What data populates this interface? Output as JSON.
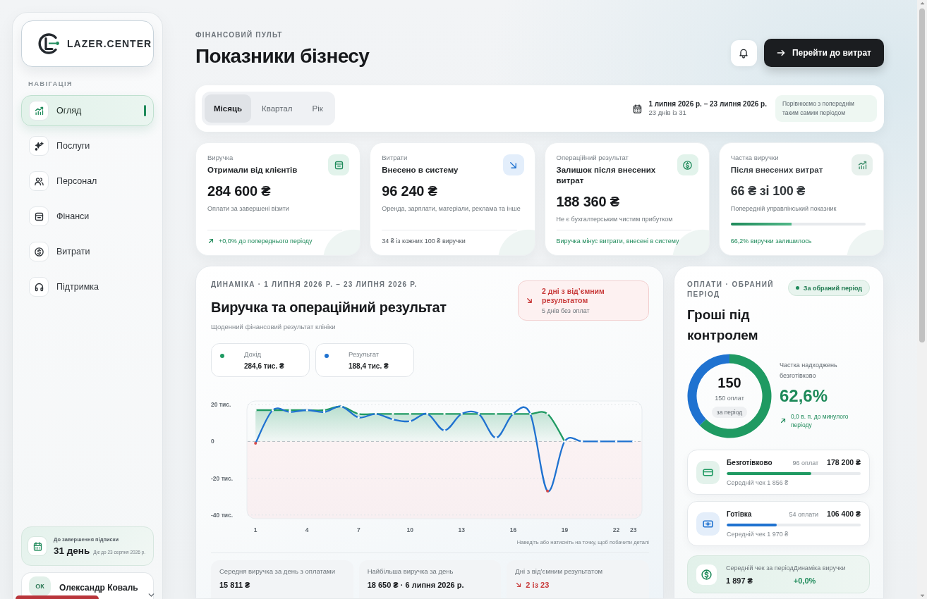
{
  "sidebar": {
    "logo": "LAZER.CENTER",
    "section_label": "НАВІГАЦІЯ",
    "items": [
      {
        "label": "Огляд",
        "selected": true
      },
      {
        "label": "Послуги",
        "selected": false
      },
      {
        "label": "Персонал",
        "selected": false
      },
      {
        "label": "Фінанси",
        "selected": false
      },
      {
        "label": "Витрати",
        "selected": false
      },
      {
        "label": "Підтримка",
        "selected": false
      }
    ],
    "subscription": {
      "label": "До завершення підписки",
      "value": "31 день",
      "note": "Діє до 23 серпня 2026 р."
    },
    "user": {
      "initials": "ОК",
      "name": "Олександр Коваль"
    }
  },
  "header": {
    "eyebrow": "ФІНАНСОВИЙ ПУЛЬТ",
    "title": "Показники бізнесу",
    "action": "Перейти до витрат"
  },
  "period_bar": {
    "tabs": [
      {
        "label": "Місяць",
        "selected": true
      },
      {
        "label": "Квартал",
        "selected": false
      },
      {
        "label": "Рік",
        "selected": false
      }
    ],
    "range": "1 липня 2026 р. – 23 липня 2026 р.",
    "days": "23 днів із 31",
    "note": "Порівнюємо з попереднім таким самим періодом"
  },
  "kpis": [
    {
      "kind": "plain",
      "label": "Виручка",
      "title": "Отримали від клієнтів",
      "value": "284 600 ₴",
      "note": "Оплати за завершені візити",
      "footer": {
        "kind": "trend",
        "text": "+0,0% до попереднього періоду"
      }
    },
    {
      "kind": "plain",
      "label": "Витрати",
      "title": "Внесено в систему",
      "value": "96 240 ₴",
      "note": "Оренда, зарплати, матеріали, реклама та інше",
      "footer": {
        "kind": "muted",
        "text": "34 ₴ із кожних 100 ₴ виручки"
      }
    },
    {
      "kind": "plain",
      "label": "Операційний результат",
      "title": "Залишок після внесених витрат",
      "value": "188 360 ₴",
      "note": "Не є бухгалтерським чистим прибутком",
      "footer": {
        "kind": "positive",
        "text": "Виручка мінус витрати, внесені в систему"
      }
    },
    {
      "kind": "progress",
      "label": "Частка виручки",
      "title": "Після внесених витрат",
      "value": "66 ₴ зі 100 ₴",
      "note": "Попередній управлінський показник",
      "level": 0.45,
      "footer": {
        "kind": "positive",
        "text": "66,2% виручки залишилось"
      }
    }
  ],
  "dynamics": {
    "eyebrow": "ДИНАМІКА · 1 ЛИПНЯ 2026 Р. – 23 ЛИПНЯ 2026 Р.",
    "title": "Виручка та операційний результат",
    "subtitle": "Щоденний фінансовий результат клініки",
    "alert": {
      "title": "2 дні з від’ємним результатом",
      "note": "5 днів без оплат"
    },
    "totals": [
      "284,6 тис. ₴",
      "188,4 тис. ₴"
    ],
    "chart_data": {
      "type": "line",
      "x": [
        1,
        2,
        3,
        4,
        5,
        6,
        7,
        8,
        9,
        10,
        11,
        12,
        13,
        14,
        15,
        16,
        17,
        18,
        19,
        20,
        21,
        22,
        23
      ],
      "xlim": [
        0.5,
        23.5
      ],
      "xticks": [
        1,
        4,
        7,
        10,
        13,
        16,
        19,
        22,
        23
      ],
      "ylim": [
        -42,
        22
      ],
      "yticks": [
        {
          "value": 20,
          "label": "20 тис."
        },
        {
          "value": 0,
          "label": "0"
        },
        {
          "value": -20,
          "label": "-20 тис."
        },
        {
          "value": -40,
          "label": "-40 тис."
        }
      ],
      "grid": true,
      "ref_lines": [
        {
          "axis": "y",
          "value": 0
        }
      ],
      "series": [
        {
          "name": "Дохід",
          "type": "area",
          "color": "#1f9a62",
          "values": [
            17,
            17,
            17,
            17,
            17,
            19,
            15,
            15,
            15,
            15,
            15,
            15,
            15,
            15,
            15,
            15,
            15,
            15,
            0,
            null,
            null,
            null,
            null
          ]
        },
        {
          "name": "Результат",
          "type": "line",
          "color": "#1f72d0",
          "values": [
            -1,
            17,
            16,
            17,
            16,
            19,
            13,
            15,
            12,
            11,
            15,
            6,
            15,
            15,
            2,
            15,
            15,
            -27,
            0,
            0,
            0,
            0,
            0
          ]
        }
      ]
    },
    "hint": "Наведіть або натисніть на точку, щоб побачити деталі",
    "stats": [
      {
        "label": "Середня виручка за день з оплатами",
        "value": "15 811 ₴",
        "negative": false
      },
      {
        "label": "Найбільша виручка за день",
        "value": "18 650 ₴ · 6 липня 2026 р.",
        "negative": false
      },
      {
        "label": "Дні з від’ємним результатом",
        "value": "2 із 23",
        "negative": true
      }
    ]
  },
  "payments": {
    "eyebrow": "ОПЛАТИ · ОБРАНИЙ ПЕРІОД",
    "badge": "За обраний період",
    "title": "Гроші під контролем",
    "donut": {
      "total": "150",
      "caption": "150 оплат",
      "pill": "за період",
      "chart_data": {
        "type": "donut",
        "values": [
          62.6,
          37.4
        ]
      }
    },
    "share": {
      "label": "Частка надходжень безготівково",
      "value": "62,6%",
      "trend": "0,0 в. п. до минулого періоду"
    },
    "methods": [
      {
        "name": "Безготівково",
        "count": "96 оплат",
        "amount": "178 200 ₴",
        "level": 0.63,
        "note": "Середній чек 1 856 ₴",
        "color": "#1f9a62"
      },
      {
        "name": "Готівка",
        "count": "54 оплати",
        "amount": "106 400 ₴",
        "level": 0.375,
        "note": "Середній чек 1 970 ₴",
        "color": "#1f72d0"
      }
    ],
    "summary": [
      {
        "label": "Середній чек за період",
        "value": "1 897 ₴",
        "positive": false
      },
      {
        "label": "Динаміка виручки",
        "value": "+0,0%",
        "positive": true
      }
    ]
  }
}
